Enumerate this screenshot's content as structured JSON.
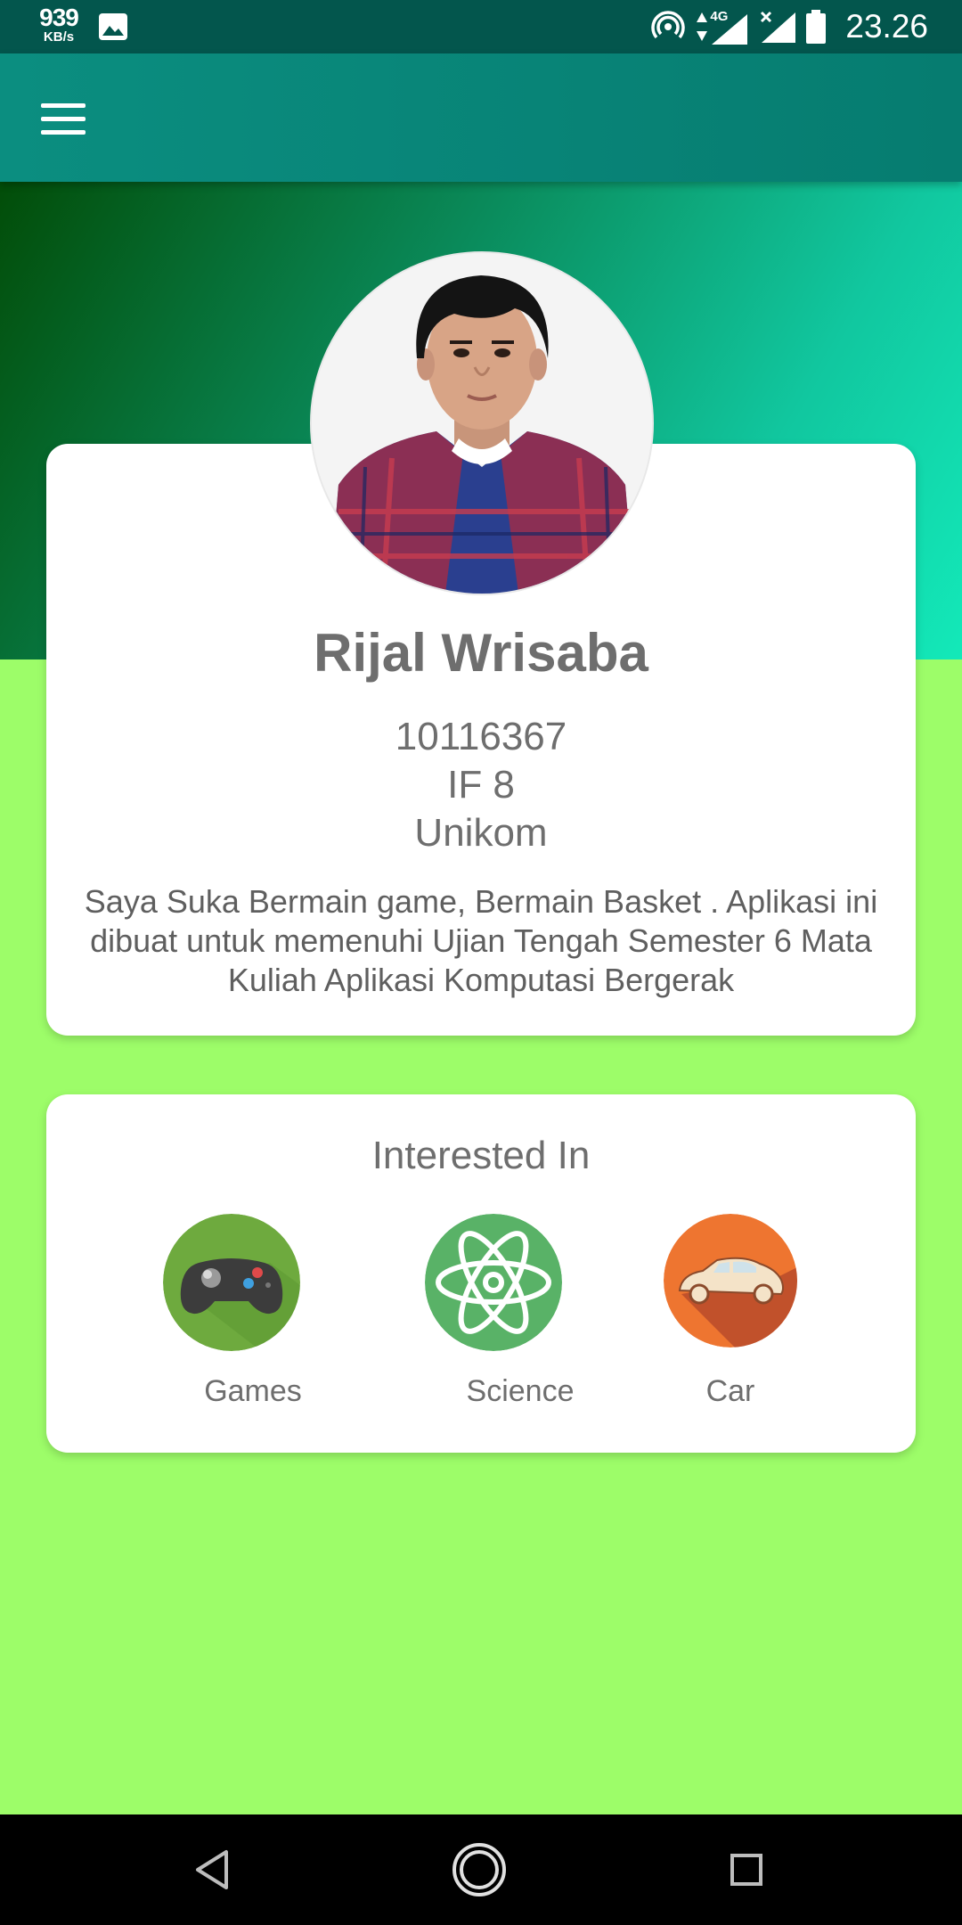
{
  "status_bar": {
    "speed_value": "939",
    "speed_unit": "KB/s",
    "network": "4G",
    "time": "23.26"
  },
  "colors": {
    "app_bar": "#078377",
    "page_background": "#9dfd69",
    "hero_gradient": [
      "#024d08",
      "#13e9b9"
    ],
    "text": "#6e6e6e"
  },
  "app_bar": {
    "menu_icon": "hamburger-menu-icon"
  },
  "profile": {
    "name": "Rijal Wrisaba",
    "student_id": "10116367",
    "class": "IF 8",
    "campus": "Unikom",
    "bio": "Saya Suka Bermain game, Bermain Basket . Aplikasi ini dibuat untuk memenuhi Ujian Tengah Semester 6 Mata Kuliah Aplikasi Komputasi Bergerak"
  },
  "interests": {
    "title": "Interested In",
    "items": [
      {
        "label": "Games",
        "icon": "gamepad-icon"
      },
      {
        "label": "Science",
        "icon": "atom-icon"
      },
      {
        "label": "Car",
        "icon": "car-icon"
      }
    ]
  },
  "nav": {
    "back_icon": "back-triangle-icon",
    "home_icon": "home-circle-icon",
    "recents_icon": "recents-square-icon"
  }
}
